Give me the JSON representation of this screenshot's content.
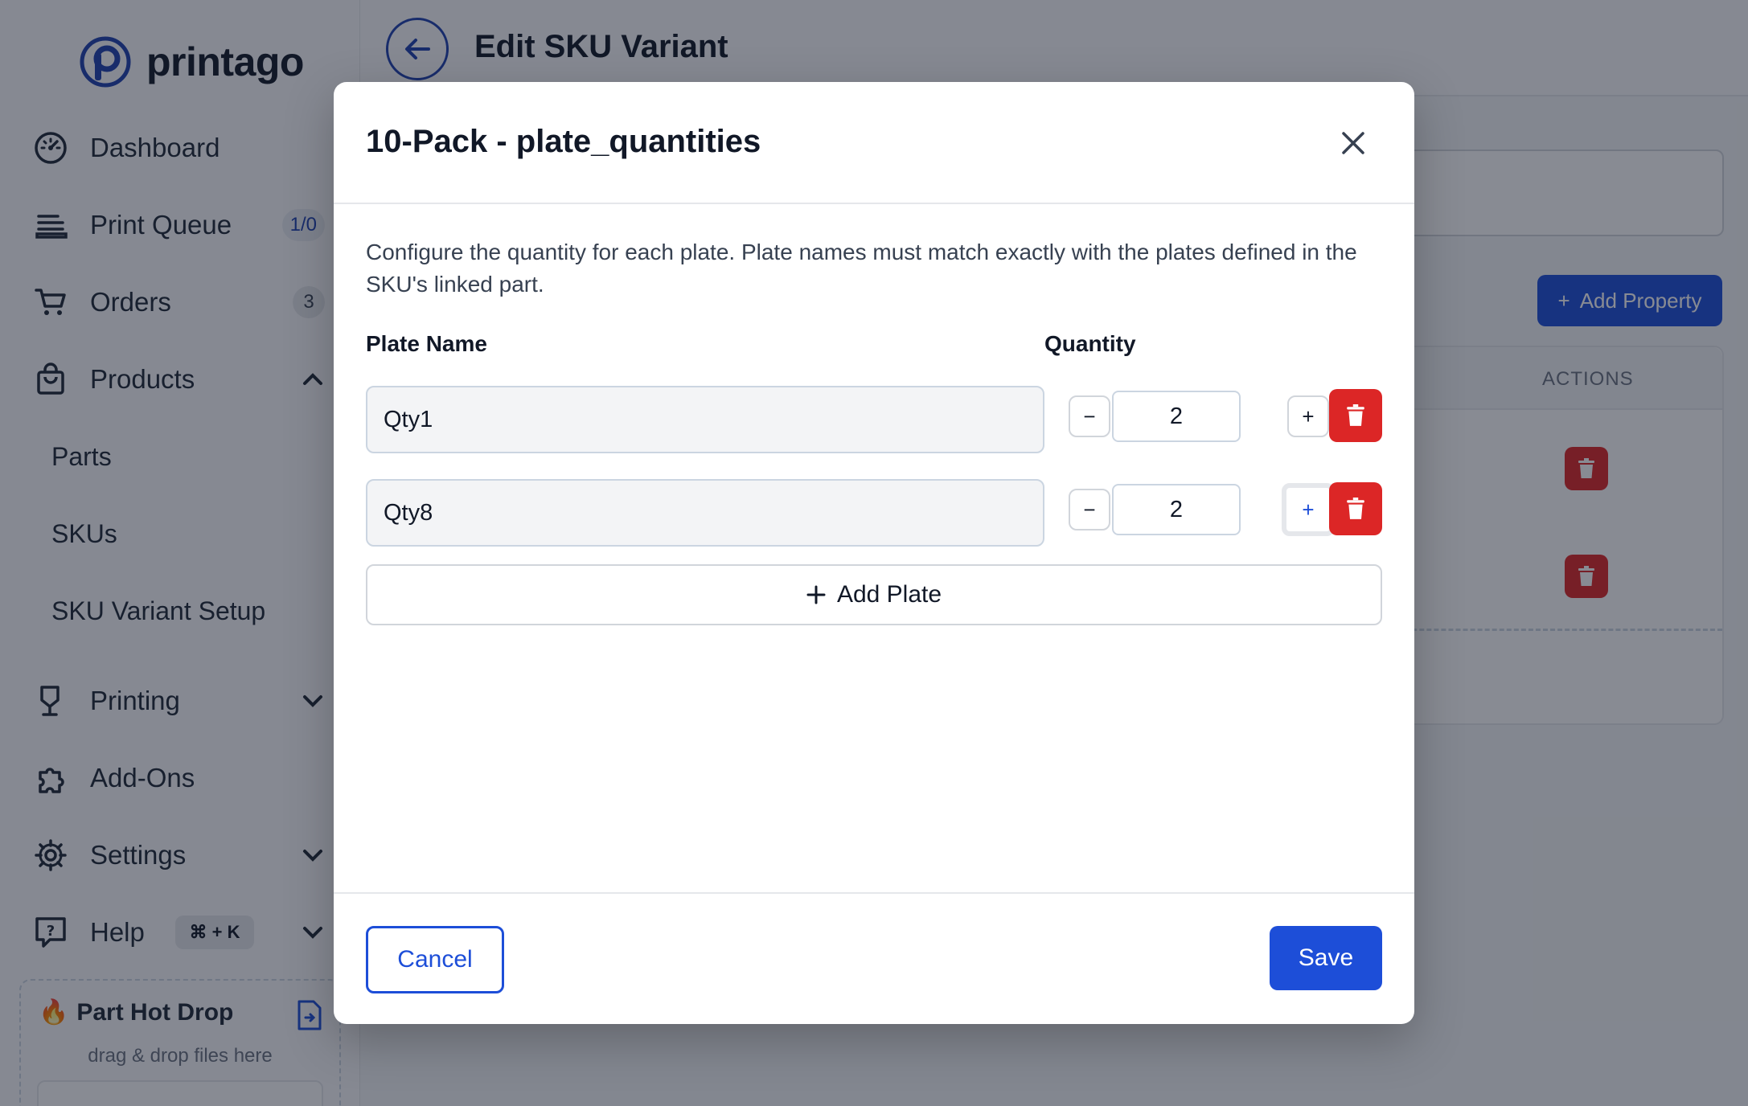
{
  "brand": {
    "name": "printago"
  },
  "sidebar": {
    "items": [
      {
        "label": "Dashboard",
        "icon": "dashboard-icon"
      },
      {
        "label": "Print Queue",
        "icon": "print-queue-icon",
        "count": "1/0"
      },
      {
        "label": "Orders",
        "icon": "cart-icon",
        "count": "3"
      },
      {
        "label": "Products",
        "icon": "bag-icon"
      },
      {
        "label": "Printing",
        "icon": "printing-icon"
      },
      {
        "label": "Add-Ons",
        "icon": "puzzle-icon"
      },
      {
        "label": "Settings",
        "icon": "gear-icon"
      },
      {
        "label": "Help",
        "icon": "help-icon",
        "shortcut": "⌘ + K"
      }
    ],
    "sub_items": [
      "Parts",
      "SKUs",
      "SKU Variant Setup"
    ],
    "hotdrop": {
      "title": "Part Hot Drop",
      "subtitle": "drag & drop files here"
    }
  },
  "page": {
    "title": "Edit SKU Variant",
    "add_property_label": "Add Property",
    "actions_header": "ACTIONS"
  },
  "modal": {
    "title": "10-Pack - plate_quantities",
    "description": "Configure the quantity for each plate. Plate names must match exactly with the plates defined in the SKU's linked part.",
    "col_plate_name": "Plate Name",
    "col_quantity": "Quantity",
    "plates": [
      {
        "name": "Qty1",
        "quantity": "2"
      },
      {
        "name": "Qty8",
        "quantity": "2"
      }
    ],
    "decrement_label": "−",
    "increment_label": "+",
    "add_plate_label": "Add Plate",
    "cancel_label": "Cancel",
    "save_label": "Save"
  },
  "colors": {
    "accent": "#1d4ed8",
    "danger": "#dc2626",
    "overlay": "rgba(17,24,39,0.5)"
  }
}
